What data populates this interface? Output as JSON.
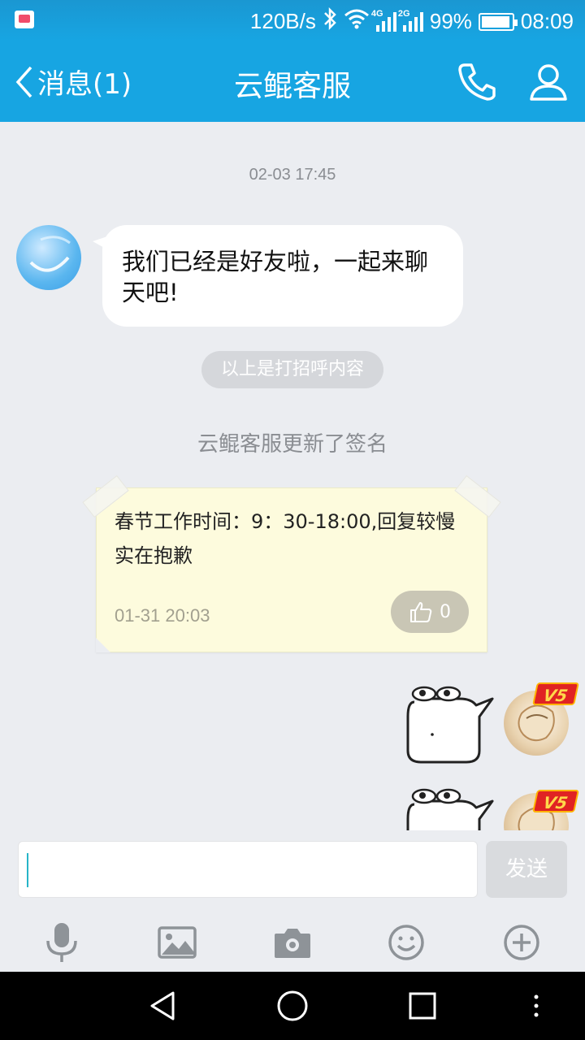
{
  "status_bar": {
    "speed": "120B/s",
    "net1_tag": "4G",
    "net2_tag": "2G",
    "battery": "99%",
    "time": "08:09",
    "icons": [
      "app-notification-icon",
      "bluetooth-icon",
      "wifi-icon",
      "signal-4g-icon",
      "signal-2g-icon",
      "battery-icon"
    ]
  },
  "header": {
    "back_label": "消息(1)",
    "title": "云鲲客服",
    "accent": "#17a5e2"
  },
  "chat": {
    "timestamp": "02-03 17:45",
    "incoming_message": "我们已经是好友啦，一起来聊天吧!",
    "greeting_notice": "以上是打招呼内容",
    "signature_notice": "云鲲客服更新了签名",
    "signature_note": {
      "text": "春节工作时间：9：30-18:00,回复较慢实在抱歉",
      "date": "01-31 20:03",
      "likes": "0"
    },
    "vip_badge": "V5"
  },
  "input": {
    "placeholder": "",
    "send_label": "发送"
  },
  "toolbar": {
    "icons": [
      "microphone-icon",
      "image-icon",
      "camera-icon",
      "emoji-icon",
      "plus-icon"
    ]
  },
  "navbar": {
    "icons": [
      "back-triangle-icon",
      "home-circle-icon",
      "recents-square-icon",
      "more-dots-icon"
    ]
  }
}
